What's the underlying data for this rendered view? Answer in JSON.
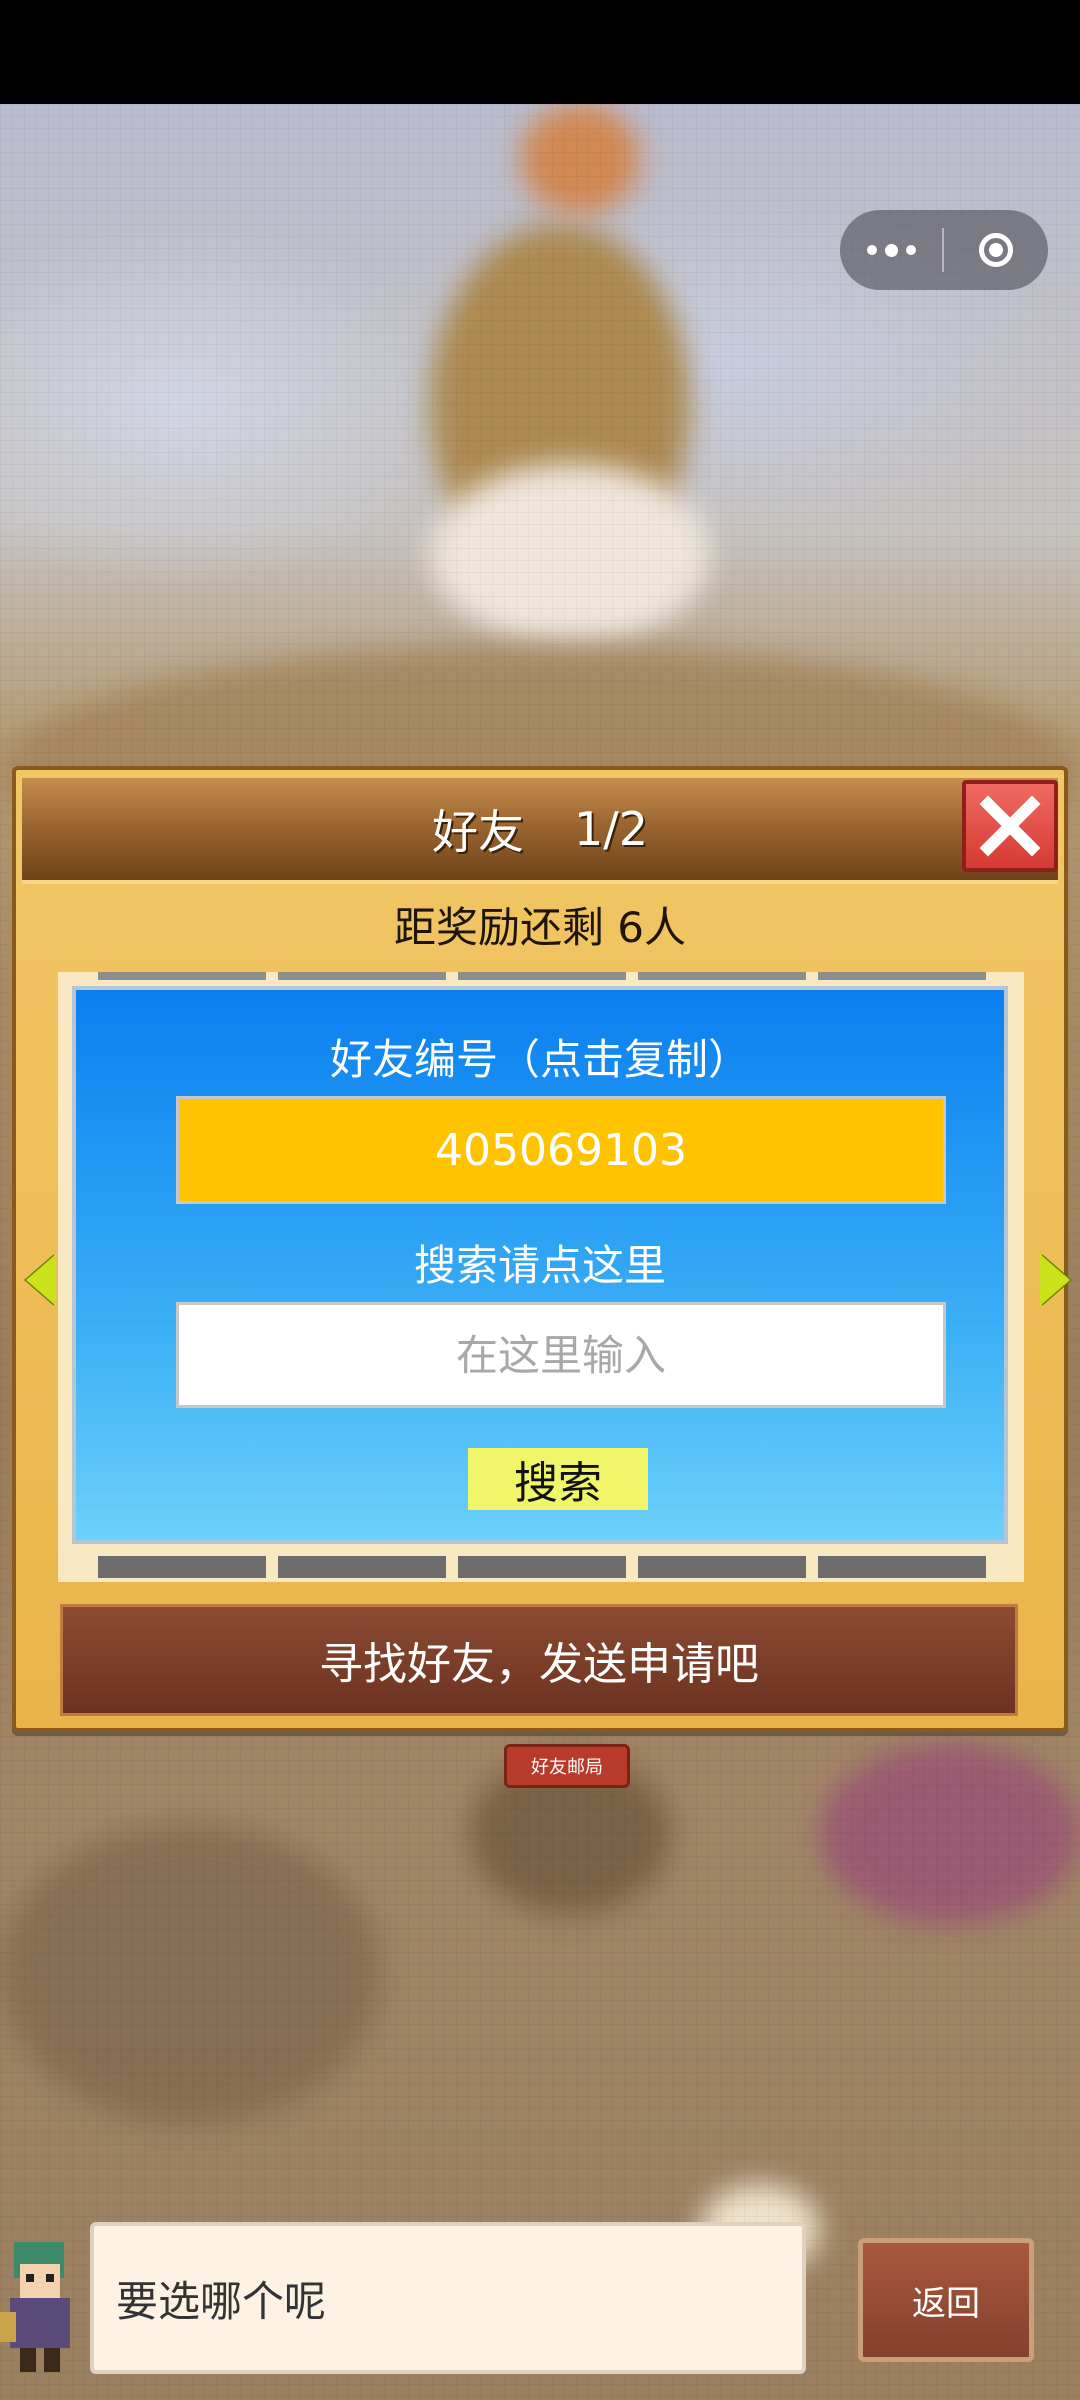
{
  "dialog": {
    "title": "好友",
    "page_indicator": "1/2",
    "reward_text": "距奖励还剩 6人",
    "friend_code_label": "好友编号（点击复制）",
    "friend_code": "405069103",
    "search_label": "搜索请点这里",
    "search_placeholder": "在这里输入",
    "search_button": "搜索",
    "find_friends_button": "寻找好友，发送申请吧"
  },
  "world": {
    "sign_label": "好友邮局"
  },
  "bottom": {
    "speech_text": "要选哪个呢",
    "back_button": "返回"
  },
  "icons": {
    "close": "close-icon",
    "more": "more-dots-icon",
    "target": "target-icon",
    "prev": "arrow-left-icon",
    "next": "arrow-right-icon"
  },
  "colors": {
    "code_box": "#ffc300",
    "search_button": "#f0f56a",
    "panel_top": "#0a7ff0",
    "close_button": "#e0463e"
  }
}
